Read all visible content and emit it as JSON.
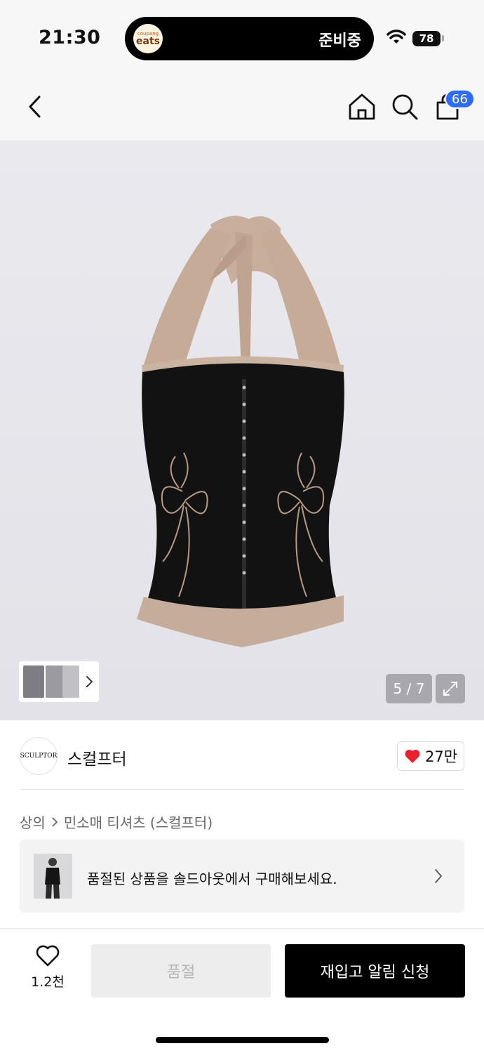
{
  "status_bar": {
    "time": "21:30",
    "live_activity": {
      "app_logo_top": "coupang",
      "app_logo_bottom": "eats",
      "status": "준비중"
    },
    "battery": "78",
    "icons": [
      "wifi-icon",
      "battery-icon"
    ]
  },
  "nav": {
    "icons": [
      "back-icon",
      "home-icon",
      "search-icon",
      "cart-icon"
    ],
    "cart_badge": "66"
  },
  "gallery": {
    "page_indicator": "5 / 7",
    "accent_badge": "#2e6cf6",
    "icons": [
      "chevron-right-icon",
      "expand-icon"
    ]
  },
  "brand": {
    "logo_text": "SCULPTOR",
    "name": "스컬프터",
    "likes": "27만",
    "like_color": "#e8212e"
  },
  "breadcrumb": {
    "items": [
      "상의",
      "민소매 티셔츠 (스컬프터)"
    ]
  },
  "soldout_banner": {
    "text": "품절된 상품을 솔드아웃에서 구매해보세요."
  },
  "bottom_bar": {
    "wish_count": "1.2천",
    "soldout_label": "품절",
    "restock_label": "재입고 알림 신청"
  }
}
